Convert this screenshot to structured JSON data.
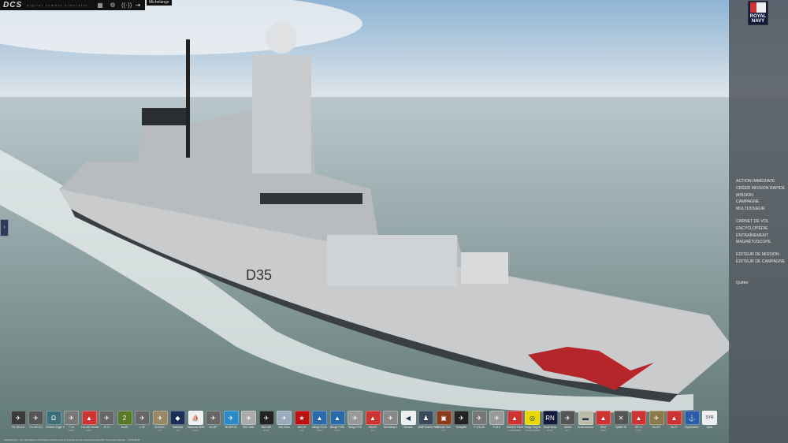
{
  "topbar": {
    "logo": "DCS",
    "tagline": "digital combat simulator",
    "icons": [
      "grid-icon",
      "gear-icon",
      "signal-icon",
      "exit-icon"
    ],
    "user": "Michelange"
  },
  "brand": {
    "line1": "ROYAL",
    "line2": "NAVY"
  },
  "menu": [
    "ACTION IMMÉDIATE",
    "CRÉER MISSION RAPIDE",
    "MISSION",
    "CAMPAGNE",
    "MULTIJOUEUR",
    "CARNET DE VOL",
    "ENCYCLOPÉDIE",
    "ENTRAÎNEMENT",
    "MAGNÉTOSCOPE",
    "ÉDITEUR DE MISSION",
    "ÉDITEUR DE CAMPAGNE",
    "Quitter"
  ],
  "left_tab": "›",
  "ship": {
    "hull_number": "D35"
  },
  "modules": [
    {
      "label": "Fw 190 A-8",
      "version": "",
      "color": "#3a3a3a",
      "glyph": "✈"
    },
    {
      "label": "Fw 190 D-9",
      "version": "",
      "color": "#555",
      "glyph": "✈"
    },
    {
      "label": "Christen Eagle II",
      "version": "",
      "color": "#3d6f7a",
      "glyph": "Ω"
    },
    {
      "label": "F-14",
      "version": "2.5.6",
      "color": "#777",
      "glyph": "✈"
    },
    {
      "label": "F/A-18C Hornet",
      "version": "2.5.6",
      "color": "#c33",
      "glyph": "▲"
    },
    {
      "label": "JF-17",
      "version": "",
      "color": "#666",
      "glyph": "✈"
    },
    {
      "label": "Ka-50",
      "version": "",
      "color": "#5a7a2a",
      "glyph": "2"
    },
    {
      "label": "L-39",
      "version": "",
      "color": "#666",
      "glyph": "✈"
    },
    {
      "label": "M-2000C",
      "version": "2.5",
      "color": "#998866",
      "glyph": "✈"
    },
    {
      "label": "Marianas",
      "version": "2.5",
      "color": "#1a2f55",
      "glyph": "◆"
    },
    {
      "label": "Marianas WWII",
      "version": "2.5.6",
      "color": "#f0f0f0",
      "glyph": "⛵"
    },
    {
      "label": "Mi-24P",
      "version": "",
      "color": "#666",
      "glyph": "✈"
    },
    {
      "label": "Mi-8MTV2",
      "version": "",
      "color": "#2a8ac8",
      "glyph": "✈"
    },
    {
      "label": "MiG-15bis",
      "version": "",
      "color": "#aaa",
      "glyph": "✈"
    },
    {
      "label": "MiG-19P",
      "version": "2.5.6",
      "color": "#222",
      "glyph": "✈"
    },
    {
      "label": "MiG-21bis",
      "version": "",
      "color": "#9ab",
      "glyph": "✈"
    },
    {
      "label": "MiG-29",
      "version": "2.5",
      "color": "#b11",
      "glyph": "★"
    },
    {
      "label": "Mirage F1CE",
      "version": "2.5.6",
      "color": "#2a6aa8",
      "glyph": "▲"
    },
    {
      "label": "Mirage F1EE",
      "version": "2.5.6",
      "color": "#2a6aa8",
      "glyph": "▲"
    },
    {
      "label": "Mirage F1M",
      "version": "",
      "color": "#999",
      "glyph": "✈"
    },
    {
      "label": "NS430",
      "version": "2.5",
      "color": "#c33",
      "glyph": "▲"
    },
    {
      "label": "Normandy 2",
      "version": "",
      "color": "#888",
      "glyph": "✈"
    },
    {
      "label": "Nevada",
      "version": "",
      "color": "#eee",
      "glyph": "◀"
    },
    {
      "label": "WWII Assets Pack",
      "version": "",
      "color": "#3a4a5a",
      "glyph": "♟"
    },
    {
      "label": "Persian Gulf",
      "version": "2.5",
      "color": "#8a3a1a",
      "glyph": "▣"
    },
    {
      "label": "Mosquito",
      "version": "",
      "color": "#222",
      "glyph": "✈"
    },
    {
      "label": "P-47D-30",
      "version": "",
      "color": "#777",
      "glyph": "✈"
    },
    {
      "label": "P-51D",
      "version": "",
      "color": "#999",
      "glyph": "✈"
    },
    {
      "label": "RAFALE PACK",
      "version": "2.5.6.55960",
      "color": "#c33",
      "glyph": "▲"
    },
    {
      "label": "Range Targets",
      "version": "14 NOV 2019",
      "color": "#e8d800",
      "glyph": "◎"
    },
    {
      "label": "Royal Navy",
      "version": "2.5.6",
      "color": "#111a3a",
      "glyph": "RN"
    },
    {
      "label": "SA342",
      "version": "2.7",
      "color": "#555",
      "glyph": "✈"
    },
    {
      "label": "ScudLauncher",
      "version": "",
      "color": "#bba",
      "glyph": "▬"
    },
    {
      "label": "SEM",
      "version": "2.5.6",
      "color": "#c33",
      "glyph": "▲"
    },
    {
      "label": "Spitfire IX",
      "version": "",
      "color": "#555",
      "glyph": "✕"
    },
    {
      "label": "SR-71",
      "version": "2.7.5",
      "color": "#c33",
      "glyph": "▲"
    },
    {
      "label": "Su-25T",
      "version": "",
      "color": "#8a7a4a",
      "glyph": "✈"
    },
    {
      "label": "Su-27",
      "version": "",
      "color": "#c33",
      "glyph": "▲"
    },
    {
      "label": "Supercarrier",
      "version": "",
      "color": "#2a5aa8",
      "glyph": "⚓"
    },
    {
      "label": "Syria",
      "version": "",
      "color": "#eee",
      "glyph": "SYR"
    }
  ],
  "disclaimer": "Avertissement : Les informations et illustrations fournies sont la propriété de leurs détenteurs respectifs. Tous droits réservés — DCS World."
}
